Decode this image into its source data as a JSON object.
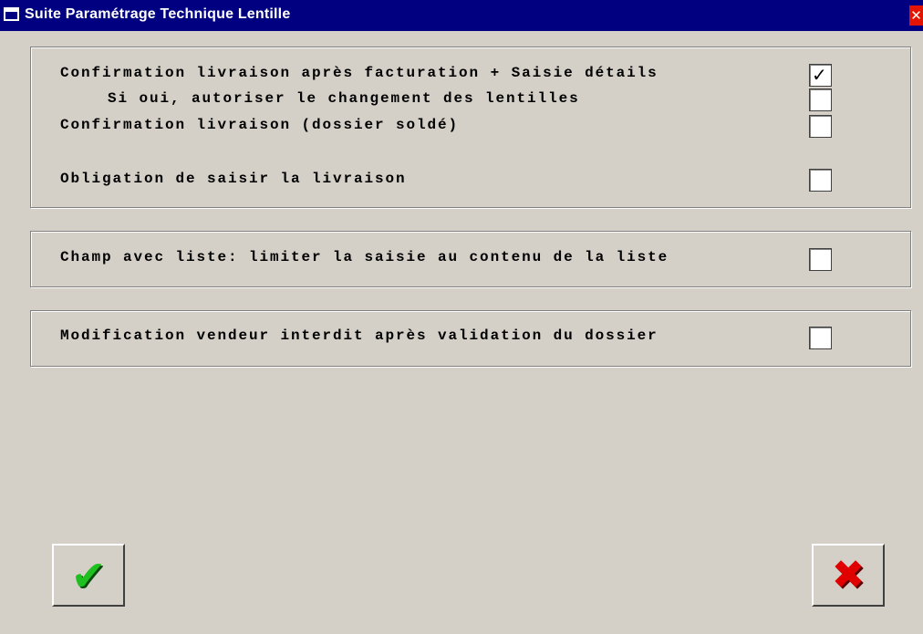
{
  "window": {
    "title": "Suite Paramétrage Technique Lentille",
    "close_symbol": "✕"
  },
  "group1": {
    "rows": [
      {
        "label": "Confirmation livraison après facturation + Saisie détails",
        "checked": true
      },
      {
        "label": "Si oui, autoriser le changement des lentilles",
        "checked": false
      },
      {
        "label": "Confirmation livraison (dossier soldé)",
        "checked": false
      },
      {
        "label": "Obligation de saisir la livraison",
        "checked": false
      }
    ]
  },
  "group2": {
    "label": "Champ avec liste: limiter la saisie au contenu de la liste",
    "checked": false
  },
  "group3": {
    "label": "Modification vendeur interdit après validation du dossier",
    "checked": false
  },
  "buttons": {
    "ok": {
      "icon": "green-checkmark-icon",
      "glyph": "✔",
      "color": "#1fbf1f"
    },
    "cancel": {
      "icon": "red-x-icon",
      "glyph": "✖",
      "color": "#e00000"
    }
  },
  "check_glyph": "✓"
}
